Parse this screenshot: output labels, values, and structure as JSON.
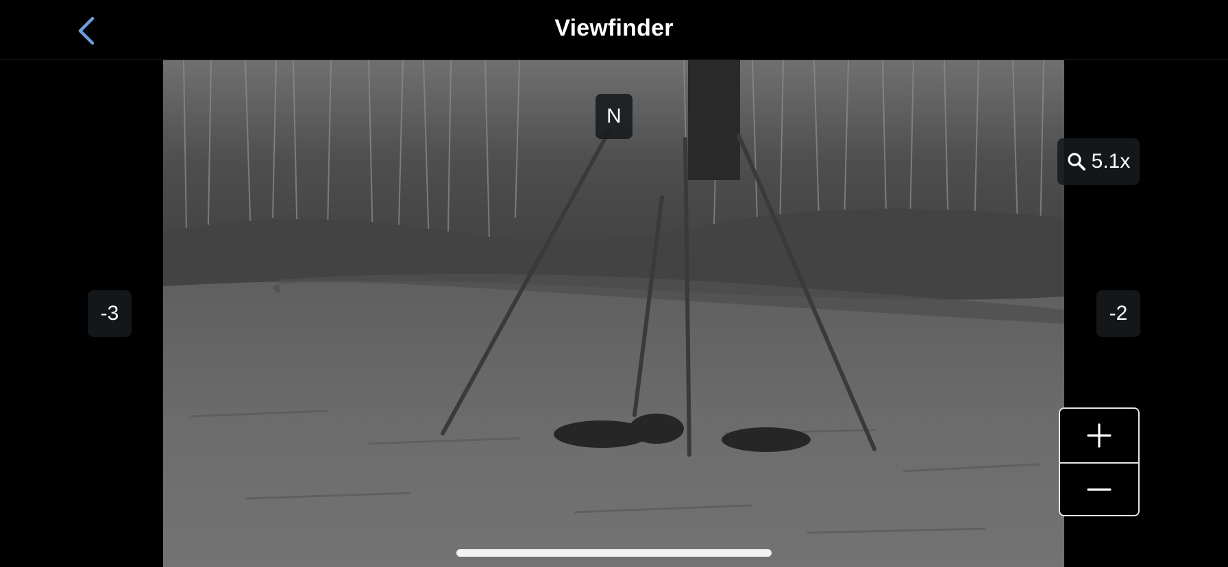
{
  "header": {
    "title": "Viewfinder",
    "back_icon": "chevron-left-icon",
    "accent_color": "#6f9fdc"
  },
  "viewfinder": {
    "compass_heading": "N",
    "zoom": {
      "icon": "search-icon",
      "level": "5.1x"
    },
    "left_offset": "-3",
    "right_offset": "-2",
    "zoom_in_icon": "plus-icon",
    "zoom_out_icon": "minus-icon"
  },
  "colors": {
    "background": "#000000",
    "chip_background": "#161a1e",
    "text": "#ffffff"
  }
}
